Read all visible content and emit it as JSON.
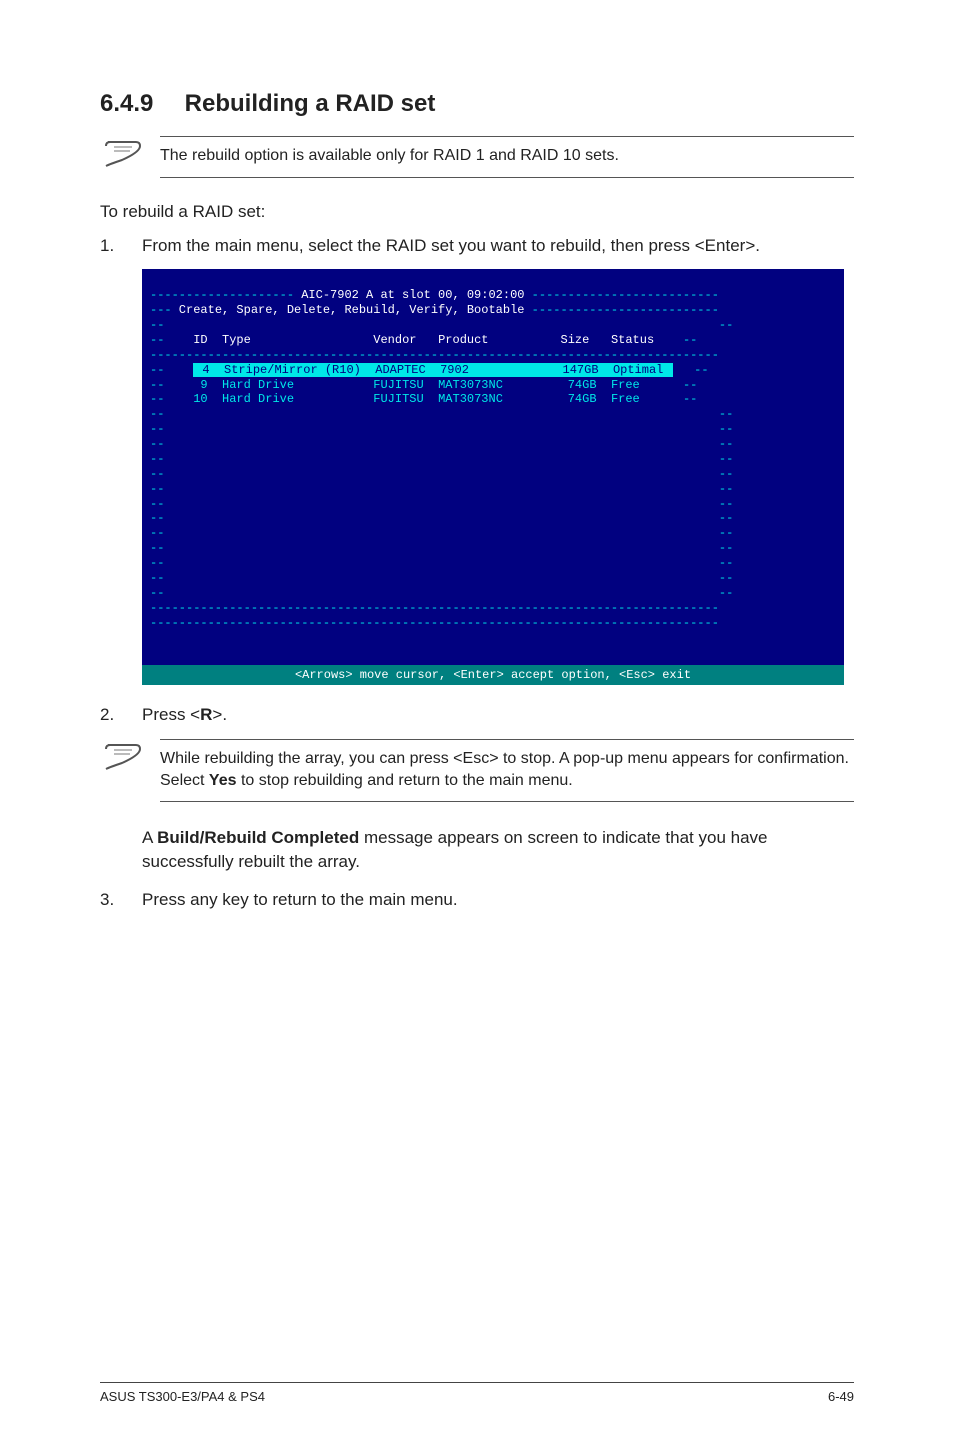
{
  "heading": {
    "number": "6.4.9",
    "title": "Rebuilding a RAID set"
  },
  "note1": "The rebuild option is available only for RAID 1 and RAID 10 sets.",
  "intro": "To rebuild a RAID set:",
  "step1": {
    "num": "1.",
    "text": "From the main menu, select the RAID set you want to rebuild, then press <Enter>."
  },
  "bios": {
    "title_left_dashes": "--------------------",
    "title_center": " AIC-7902 A at slot 00, 09:02:00 ",
    "title_right_dashes": "--------------------------",
    "menu_left": "---",
    "menu_text": " Create, Spare, Delete, Rebuild, Verify, Bootable ",
    "menu_right": "--------------------------",
    "col_id": "ID",
    "col_type": "Type",
    "col_vendor": "Vendor",
    "col_product": "Product",
    "col_size": "Size",
    "col_status": "Status",
    "rows": [
      {
        "id": "4",
        "type": "Stripe/Mirror (R10)",
        "vendor": "ADAPTEC",
        "product": "7902",
        "size": "147GB",
        "status": "Optimal",
        "selected": true
      },
      {
        "id": "9",
        "type": "Hard Drive",
        "vendor": "FUJITSU",
        "product": "MAT3073NC",
        "size": "74GB",
        "status": "Free",
        "selected": false
      },
      {
        "id": "10",
        "type": "Hard Drive",
        "vendor": "FUJITSU",
        "product": "MAT3073NC",
        "size": "74GB",
        "status": "Free",
        "selected": false
      }
    ],
    "footer": "<Arrows> move cursor, <Enter> accept option, <Esc> exit"
  },
  "step2": {
    "num": "2.",
    "pre": "Press <",
    "key": "R",
    "post": ">."
  },
  "note2": {
    "part1": "While rebuilding the array, you can press <Esc> to stop. A pop-up menu appears for confirmation. Select ",
    "bold": "Yes",
    "part2": " to stop rebuilding and return to the main menu."
  },
  "completed": {
    "pre": "A ",
    "bold": "Build/Rebuild Completed",
    "post": " message appears on screen to indicate that you have successfully rebuilt the array."
  },
  "step3": {
    "num": "3.",
    "text": "Press any key to return to the main menu."
  },
  "footer": {
    "left": "ASUS TS300-E3/PA4 & PS4",
    "right": "6-49"
  }
}
